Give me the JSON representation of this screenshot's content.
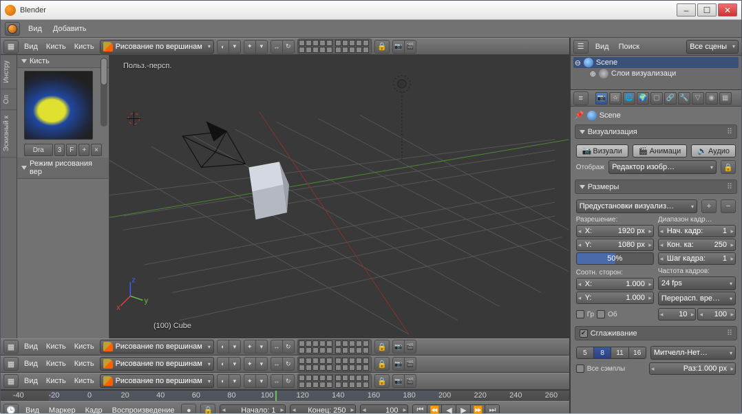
{
  "window": {
    "title": "Blender"
  },
  "win_controls": {
    "min": "–",
    "max": "☐",
    "close": "✕"
  },
  "info_header": {
    "menu1": "Вид",
    "menu2": "Добавить"
  },
  "viewheader": {
    "menu_view": "Вид",
    "menu_brush": "Кисть",
    "menu_brush2": "Кисть",
    "mode_label": "Рисование по вершинам"
  },
  "toolshelf": {
    "tabs": [
      "Инстру",
      "Оп",
      "Эскизный к"
    ],
    "panel_brush": "Кисть",
    "brush_name": "Dra",
    "brush_count": "3",
    "brush_fake": "F",
    "panel_paintmode": "Режим рисования вер"
  },
  "viewport": {
    "persp": "Польз.-персп.",
    "obj_label": "(100) Cube"
  },
  "timeline": {
    "menu_view": "Вид",
    "menu_marker": "Маркер",
    "menu_frame": "Кадр",
    "menu_play": "Воспроизведение",
    "start_label": "Начало:",
    "start_val": "1",
    "end_label": "Конец:",
    "end_val": "250",
    "cur": "100",
    "ticks": [
      "-40",
      "-20",
      "0",
      "20",
      "40",
      "60",
      "80",
      "100",
      "120",
      "140",
      "160",
      "180",
      "200",
      "220",
      "240",
      "260"
    ]
  },
  "outliner": {
    "menu_view": "Вид",
    "menu_search": "Поиск",
    "filter": "Все сцены",
    "scene": "Scene",
    "layers": "Слои визуализаци"
  },
  "properties": {
    "breadcrumb": "Scene",
    "sec_render": "Визуализация",
    "btn_render": "Визуали",
    "btn_anim": "Анимаци",
    "btn_audio": "Аудио",
    "display_lbl": "Отображ",
    "display_val": "Редактор изобр…",
    "sec_dims": "Размеры",
    "preset_val": "Предустановки визуализ…",
    "res_lbl": "Разрешение:",
    "range_lbl": "Диапазон кадр…",
    "x_label": "X:",
    "x_val": "1920 px",
    "y_label": "Y:",
    "y_val": "1080 px",
    "scale_val": "50%",
    "start_k": "Нач. кадр:",
    "start_v": "1",
    "end_k": "Кон. ка:",
    "end_v": "250",
    "step_k": "Шаг кадра:",
    "step_v": "1",
    "aspect_lbl": "Соотн. сторон:",
    "fps_lbl": "Частота кадров:",
    "ax_k": "X:",
    "ax_v": "1.000",
    "ay_k": "Y:",
    "ay_v": "1.000",
    "fps_val": "24 fps",
    "remap_val": "Перерасп. вре…",
    "border_lbl": "Гр",
    "crop_lbl": "Об",
    "old_val": "10",
    "new_val": "100",
    "sec_aa": "Сглаживание",
    "aa_5": "5",
    "aa_8": "8",
    "aa_11": "11",
    "aa_16": "16",
    "aa_filter": "Митчелл-Нет…",
    "all_samples": "Все сэмплы",
    "pixel_size": "Раз:1.000 px"
  }
}
